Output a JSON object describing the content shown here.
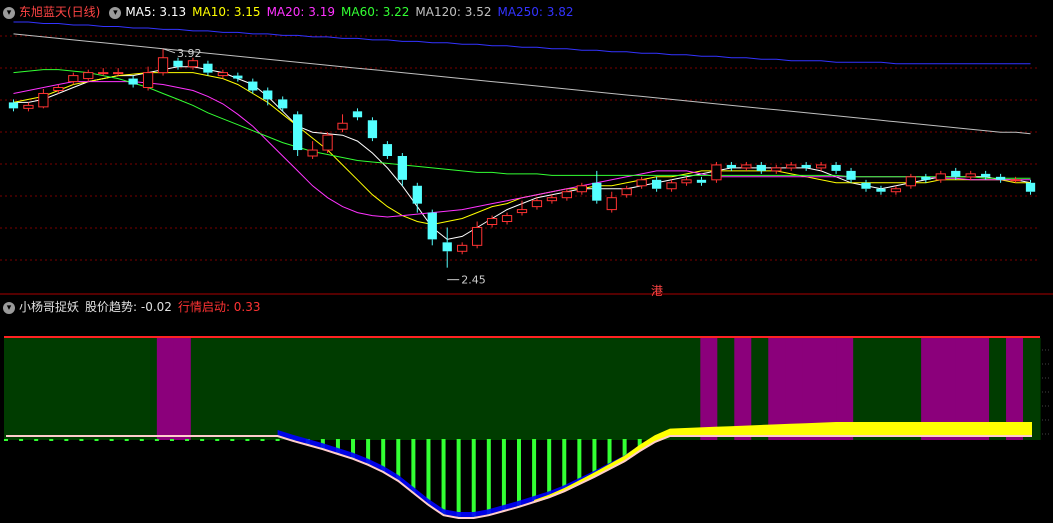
{
  "top_panel": {
    "stock_name": "东旭蓝天(日线)",
    "ma_items": [
      {
        "label": "MA5: 3.13",
        "color": "#ffffff"
      },
      {
        "label": "MA10: 3.15",
        "color": "#ffff00"
      },
      {
        "label": "MA20: 3.19",
        "color": "#ff33ff"
      },
      {
        "label": "MA60: 3.22",
        "color": "#33ff33"
      },
      {
        "label": "MA120: 3.52",
        "color": "#c0c0c0"
      },
      {
        "label": "MA250: 3.82",
        "color": "#3333ff"
      }
    ],
    "max_label": "3.92",
    "min_label": "2.45",
    "marker": "港"
  },
  "bottom_panel": {
    "indicator_name": "小杨哥捉妖",
    "trend_label": "股价趋势: -0.02",
    "signal_label": "行情启动: 0.33"
  },
  "colors": {
    "up": "#ff3333",
    "down": "#54ffff",
    "grid": "#7a0000",
    "green_band": "#003c00",
    "purple_band": "#8b007b",
    "bright_green": "#33ff33",
    "yellow": "#ffff00",
    "blue": "#0000ff",
    "pink": "#ffcccc"
  },
  "chart_data": [
    {
      "type": "candlestick",
      "title": "东旭蓝天(日线)",
      "ylim": [
        2.3,
        4.1
      ],
      "candles": [
        [
          3.56,
          3.52,
          3.58,
          3.5
        ],
        [
          3.52,
          3.54,
          3.56,
          3.5
        ],
        [
          3.53,
          3.62,
          3.65,
          3.52
        ],
        [
          3.64,
          3.66,
          3.68,
          3.62
        ],
        [
          3.7,
          3.74,
          3.76,
          3.68
        ],
        [
          3.72,
          3.76,
          3.78,
          3.7
        ],
        [
          3.76,
          3.76,
          3.79,
          3.74
        ],
        [
          3.76,
          3.76,
          3.79,
          3.74
        ],
        [
          3.72,
          3.68,
          3.74,
          3.66
        ],
        [
          3.66,
          3.76,
          3.8,
          3.64
        ],
        [
          3.76,
          3.86,
          3.92,
          3.74
        ],
        [
          3.84,
          3.8,
          3.86,
          3.78
        ],
        [
          3.8,
          3.84,
          3.86,
          3.78
        ],
        [
          3.82,
          3.76,
          3.84,
          3.74
        ],
        [
          3.74,
          3.76,
          3.78,
          3.72
        ],
        [
          3.74,
          3.72,
          3.76,
          3.7
        ],
        [
          3.7,
          3.64,
          3.72,
          3.62
        ],
        [
          3.64,
          3.58,
          3.66,
          3.54
        ],
        [
          3.58,
          3.52,
          3.6,
          3.5
        ],
        [
          3.48,
          3.24,
          3.5,
          3.2
        ],
        [
          3.2,
          3.24,
          3.3,
          3.18
        ],
        [
          3.24,
          3.34,
          3.36,
          3.22
        ],
        [
          3.38,
          3.42,
          3.48,
          3.36
        ],
        [
          3.5,
          3.46,
          3.52,
          3.44
        ],
        [
          3.44,
          3.32,
          3.46,
          3.3
        ],
        [
          3.28,
          3.2,
          3.3,
          3.18
        ],
        [
          3.2,
          3.04,
          3.22,
          3.0
        ],
        [
          3.0,
          2.88,
          3.02,
          2.82
        ],
        [
          2.82,
          2.64,
          2.84,
          2.6
        ],
        [
          2.62,
          2.56,
          2.72,
          2.45
        ],
        [
          2.56,
          2.6,
          2.62,
          2.54
        ],
        [
          2.6,
          2.72,
          2.76,
          2.58
        ],
        [
          2.74,
          2.78,
          2.8,
          2.72
        ],
        [
          2.76,
          2.8,
          2.82,
          2.74
        ],
        [
          2.82,
          2.84,
          2.9,
          2.8
        ],
        [
          2.86,
          2.9,
          2.92,
          2.84
        ],
        [
          2.9,
          2.92,
          2.94,
          2.88
        ],
        [
          2.92,
          2.96,
          2.98,
          2.9
        ],
        [
          2.96,
          3.0,
          3.02,
          2.94
        ],
        [
          3.02,
          2.9,
          3.1,
          2.88
        ],
        [
          2.84,
          2.92,
          2.96,
          2.82
        ],
        [
          2.94,
          2.98,
          3.0,
          2.92
        ],
        [
          3.0,
          3.04,
          3.06,
          2.98
        ],
        [
          3.04,
          2.98,
          3.06,
          2.96
        ],
        [
          2.98,
          3.02,
          3.04,
          2.96
        ],
        [
          3.02,
          3.04,
          3.06,
          3.0
        ],
        [
          3.04,
          3.02,
          3.06,
          3.0
        ],
        [
          3.04,
          3.14,
          3.16,
          3.02
        ],
        [
          3.14,
          3.12,
          3.16,
          3.1
        ],
        [
          3.12,
          3.14,
          3.16,
          3.1
        ],
        [
          3.14,
          3.1,
          3.16,
          3.08
        ],
        [
          3.1,
          3.12,
          3.14,
          3.08
        ],
        [
          3.12,
          3.14,
          3.16,
          3.1
        ],
        [
          3.14,
          3.12,
          3.16,
          3.1
        ],
        [
          3.12,
          3.14,
          3.16,
          3.1
        ],
        [
          3.14,
          3.1,
          3.16,
          3.08
        ],
        [
          3.1,
          3.04,
          3.12,
          3.02
        ],
        [
          3.02,
          2.98,
          3.04,
          2.96
        ],
        [
          2.98,
          2.96,
          3.0,
          2.94
        ],
        [
          2.96,
          2.98,
          3.0,
          2.94
        ],
        [
          3.0,
          3.06,
          3.08,
          2.98
        ],
        [
          3.06,
          3.04,
          3.08,
          3.02
        ],
        [
          3.04,
          3.08,
          3.1,
          3.02
        ],
        [
          3.1,
          3.06,
          3.12,
          3.04
        ],
        [
          3.06,
          3.08,
          3.1,
          3.04
        ],
        [
          3.08,
          3.06,
          3.1,
          3.04
        ],
        [
          3.06,
          3.04,
          3.08,
          3.02
        ],
        [
          3.04,
          3.04,
          3.06,
          3.02
        ],
        [
          3.02,
          2.96,
          3.04,
          2.94
        ]
      ],
      "series": [
        {
          "name": "MA5",
          "color": "#ffffff",
          "values": [
            3.56,
            3.56,
            3.58,
            3.62,
            3.66,
            3.7,
            3.72,
            3.74,
            3.74,
            3.76,
            3.78,
            3.8,
            3.8,
            3.78,
            3.76,
            3.72,
            3.68,
            3.6,
            3.5,
            3.4,
            3.36,
            3.35,
            3.34,
            3.3,
            3.22,
            3.12,
            3.0,
            2.86,
            2.72,
            2.64,
            2.66,
            2.72,
            2.78,
            2.84,
            2.88,
            2.92,
            2.94,
            2.96,
            2.98,
            2.98,
            2.98,
            2.98,
            3.0,
            3.02,
            3.04,
            3.06,
            3.08,
            3.1,
            3.12,
            3.12,
            3.12,
            3.12,
            3.12,
            3.12,
            3.1,
            3.06,
            3.02,
            3.0,
            2.98,
            3.0,
            3.02,
            3.04,
            3.06,
            3.06,
            3.06,
            3.06,
            3.04,
            3.04,
            3.02
          ]
        },
        {
          "name": "MA10",
          "color": "#ffff00",
          "values": [
            3.56,
            3.58,
            3.6,
            3.64,
            3.68,
            3.7,
            3.72,
            3.74,
            3.75,
            3.76,
            3.76,
            3.76,
            3.76,
            3.74,
            3.72,
            3.68,
            3.62,
            3.56,
            3.48,
            3.4,
            3.32,
            3.24,
            3.14,
            3.04,
            2.94,
            2.86,
            2.8,
            2.76,
            2.74,
            2.76,
            2.78,
            2.82,
            2.86,
            2.88,
            2.92,
            2.94,
            2.96,
            2.98,
            2.98,
            3.0,
            3.0,
            3.02,
            3.04,
            3.06,
            3.06,
            3.08,
            3.1,
            3.1,
            3.1,
            3.1,
            3.1,
            3.1,
            3.08,
            3.06,
            3.04,
            3.02,
            3.02,
            3.02,
            3.02,
            3.02,
            3.02,
            3.02,
            3.04,
            3.04,
            3.04,
            3.04,
            3.04,
            3.02,
            3.02
          ]
        },
        {
          "name": "MA20",
          "color": "#ff33ff",
          "values": [
            3.62,
            3.64,
            3.66,
            3.68,
            3.7,
            3.7,
            3.7,
            3.7,
            3.7,
            3.69,
            3.68,
            3.66,
            3.64,
            3.6,
            3.55,
            3.48,
            3.4,
            3.3,
            3.2,
            3.1,
            3.0,
            2.92,
            2.86,
            2.82,
            2.8,
            2.79,
            2.8,
            2.81,
            2.82,
            2.83,
            2.84,
            2.86,
            2.88,
            2.9,
            2.92,
            2.94,
            2.96,
            2.98,
            3.0,
            3.02,
            3.04,
            3.06,
            3.08,
            3.1,
            3.1,
            3.1,
            3.08,
            3.06,
            3.06,
            3.06,
            3.06,
            3.06,
            3.06,
            3.06,
            3.06,
            3.06,
            3.06,
            3.06,
            3.06,
            3.06,
            3.06,
            3.06,
            3.05,
            3.05,
            3.04,
            3.04,
            3.04,
            3.04,
            3.04
          ]
        },
        {
          "name": "MA60",
          "color": "#33ff33",
          "values": [
            3.76,
            3.77,
            3.78,
            3.78,
            3.77,
            3.76,
            3.74,
            3.72,
            3.69,
            3.66,
            3.62,
            3.58,
            3.54,
            3.49,
            3.45,
            3.41,
            3.37,
            3.33,
            3.29,
            3.26,
            3.23,
            3.21,
            3.19,
            3.17,
            3.16,
            3.15,
            3.14,
            3.13,
            3.12,
            3.11,
            3.1,
            3.09,
            3.09,
            3.08,
            3.08,
            3.08,
            3.07,
            3.07,
            3.07,
            3.07,
            3.07,
            3.07,
            3.07,
            3.07,
            3.07,
            3.07,
            3.07,
            3.07,
            3.07,
            3.07,
            3.07,
            3.07,
            3.07,
            3.07,
            3.07,
            3.07,
            3.06,
            3.06,
            3.06,
            3.06,
            3.06,
            3.06,
            3.06,
            3.06,
            3.06,
            3.05,
            3.05,
            3.05,
            3.05
          ]
        },
        {
          "name": "MA120",
          "color": "#c0c0c0",
          "values": [
            4.02,
            4.01,
            4.0,
            3.99,
            3.98,
            3.97,
            3.96,
            3.95,
            3.94,
            3.93,
            3.92,
            3.91,
            3.9,
            3.89,
            3.88,
            3.87,
            3.86,
            3.85,
            3.84,
            3.83,
            3.82,
            3.81,
            3.8,
            3.79,
            3.78,
            3.77,
            3.76,
            3.75,
            3.74,
            3.73,
            3.72,
            3.71,
            3.7,
            3.69,
            3.68,
            3.67,
            3.66,
            3.65,
            3.64,
            3.63,
            3.62,
            3.61,
            3.6,
            3.59,
            3.58,
            3.57,
            3.56,
            3.55,
            3.54,
            3.53,
            3.52,
            3.51,
            3.5,
            3.49,
            3.48,
            3.47,
            3.46,
            3.45,
            3.44,
            3.43,
            3.42,
            3.41,
            3.4,
            3.39,
            3.38,
            3.37,
            3.36,
            3.36,
            3.35
          ]
        },
        {
          "name": "MA250",
          "color": "#3333ff",
          "values": [
            4.1,
            4.1,
            4.09,
            4.09,
            4.08,
            4.08,
            4.07,
            4.07,
            4.06,
            4.06,
            4.05,
            4.05,
            4.04,
            4.04,
            4.03,
            4.03,
            4.02,
            4.02,
            4.01,
            4.01,
            4.0,
            4.0,
            3.99,
            3.99,
            3.98,
            3.98,
            3.97,
            3.97,
            3.96,
            3.96,
            3.95,
            3.95,
            3.94,
            3.94,
            3.93,
            3.93,
            3.92,
            3.92,
            3.91,
            3.91,
            3.9,
            3.9,
            3.89,
            3.89,
            3.88,
            3.88,
            3.87,
            3.87,
            3.86,
            3.86,
            3.85,
            3.85,
            3.84,
            3.84,
            3.84,
            3.83,
            3.83,
            3.83,
            3.83,
            3.82,
            3.82,
            3.82,
            3.82,
            3.82,
            3.82,
            3.82,
            3.82,
            3.82,
            3.82
          ]
        }
      ]
    },
    {
      "type": "indicator",
      "title": "小杨哥捉妖",
      "bands": [
        "green",
        "green",
        "green",
        "green",
        "green",
        "green",
        "green",
        "green",
        "green",
        "purple",
        "purple",
        "green",
        "green",
        "green",
        "green",
        "green",
        "green",
        "green",
        "green",
        "green",
        "green",
        "green",
        "green",
        "green",
        "green",
        "green",
        "green",
        "green",
        "green",
        "green",
        "green",
        "green",
        "green",
        "green",
        "green",
        "green",
        "green",
        "green",
        "green",
        "green",
        "green",
        "purple",
        "green",
        "purple",
        "green",
        "purple",
        "purple",
        "purple",
        "purple",
        "purple",
        "green",
        "green",
        "green",
        "green",
        "purple",
        "purple",
        "purple",
        "purple",
        "green",
        "purple",
        "green"
      ],
      "trend_line": [
        0.55,
        0.52,
        0.5,
        0.52,
        0.55,
        0.6,
        0.66,
        0.7,
        0.72,
        0.74,
        0.76,
        0.76,
        0.75,
        0.74,
        0.72,
        0.68,
        0.6,
        0.5,
        0.4,
        0.32,
        0.25,
        0.18,
        0.1,
        0.02,
        -0.08,
        -0.2,
        -0.35,
        -0.55,
        -0.75,
        -0.92,
        -1.0,
        -0.98,
        -0.92,
        -0.85,
        -0.78,
        -0.7,
        -0.62,
        -0.52,
        -0.4,
        -0.28,
        -0.15,
        -0.02,
        0.15,
        0.3,
        0.45,
        0.58,
        0.68,
        0.76,
        0.82,
        0.86,
        0.86,
        0.84,
        0.8,
        0.78,
        0.76,
        0.78,
        0.82,
        0.86,
        0.88,
        0.88,
        0.85,
        0.82,
        0.8,
        0.8,
        0.78,
        0.76,
        0.74,
        0.72,
        0.7
      ],
      "green_bars": [
        1,
        1,
        1,
        1,
        1,
        1,
        1,
        1,
        1,
        1,
        1,
        1,
        1,
        1,
        1,
        1,
        1,
        1,
        1,
        1,
        1,
        1,
        1,
        1,
        1,
        1,
        1,
        1,
        1,
        1,
        1,
        1,
        1,
        1,
        1,
        1,
        1,
        1,
        1,
        1,
        1,
        1,
        1,
        1,
        0,
        0,
        0,
        0,
        0,
        0,
        0,
        0,
        0,
        0,
        0,
        0,
        0,
        0,
        0,
        0,
        0,
        0,
        0,
        0,
        0,
        0,
        0,
        0,
        0
      ],
      "yellow_area_start_index": 35
    }
  ]
}
